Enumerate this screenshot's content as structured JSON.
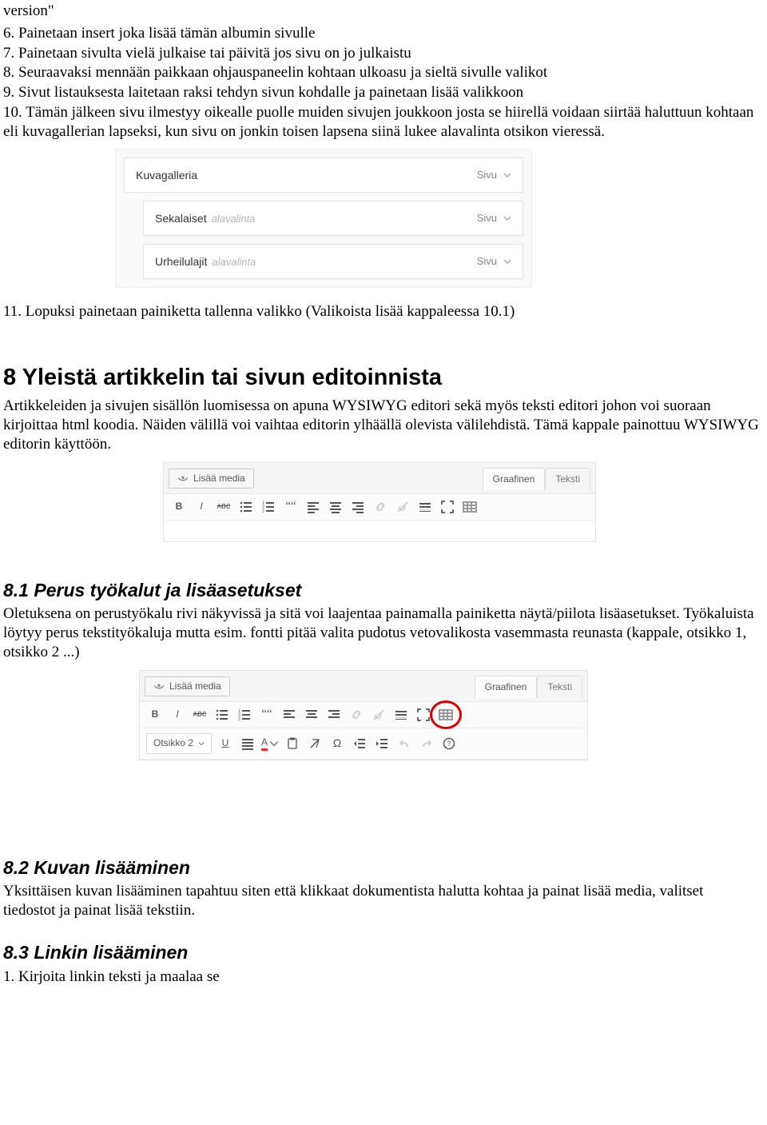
{
  "intro": {
    "line0": "version\"",
    "items": [
      "6. Painetaan insert joka lisää tämän albumin sivulle",
      "7. Painetaan sivulta vielä julkaise tai päivitä jos sivu on jo julkaistu",
      "8. Seuraavaksi mennään paikkaan ohjauspaneelin kohtaan ulkoasu ja sieltä sivulle valikot",
      "9. Sivut listauksesta laitetaan raksi tehdyn sivun kohdalle ja painetaan lisää valikkoon",
      "10. Tämän jälkeen sivu ilmestyy oikealle puolle muiden sivujen joukkoon josta se hiirellä voidaan siirtää haluttuun kohtaan eli kuvagallerian lapseksi, kun sivu on jonkin toisen lapsena siinä lukee alavalinta otsikon vieressä."
    ],
    "item11": "11. Lopuksi painetaan painiketta tallenna valikko (Valikoista lisää kappaleessa 10.1)"
  },
  "panel": {
    "type_label": "Sivu",
    "rows": [
      {
        "name": "Kuvagalleria",
        "sub": ""
      },
      {
        "name": "Sekalaiset",
        "sub": "alavalinta"
      },
      {
        "name": "Urheilulajit",
        "sub": "alavalinta"
      }
    ]
  },
  "sec8": {
    "title": "8 Yleistä artikkelin tai sivun editoinnista",
    "para": "Artikkeleiden ja sivujen sisällön luomisessa on apuna WYSIWYG editori sekä myös teksti editori johon voi suoraan kirjoittaa html koodia. Näiden välillä voi vaihtaa editorin ylhäällä olevista välilehdistä. Tämä kappale painottuu WYSIWYG editorin käyttöön."
  },
  "editor": {
    "media": "Lisää media",
    "tab_visual": "Graafinen",
    "tab_text": "Teksti",
    "format_select": "Otsikko 2"
  },
  "sec81": {
    "title": "8.1 Perus työkalut ja lisäasetukset",
    "para": "Oletuksena on perustyökalu rivi näkyvissä ja sitä voi laajentaa painamalla painiketta näytä/piilota lisäasetukset. Työkaluista löytyy perus tekstityökaluja mutta esim. fontti pitää valita pudotus vetovalikosta vasemmasta reunasta (kappale, otsikko 1, otsikko 2 ...)"
  },
  "sec82": {
    "title": "8.2 Kuvan lisääminen",
    "para": "Yksittäisen kuvan lisääminen tapahtuu siten että klikkaat dokumentista halutta kohtaa ja painat lisää media, valitset tiedostot ja painat lisää tekstiin."
  },
  "sec83": {
    "title": "8.3 Linkin lisääminen",
    "item1": "1. Kirjoita linkin teksti ja maalaa se"
  }
}
